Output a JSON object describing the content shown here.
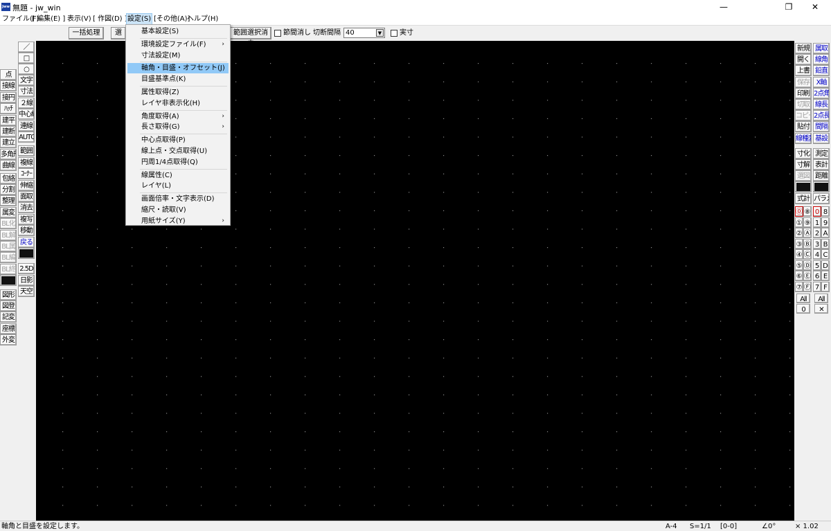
{
  "window": {
    "title": "無題 - jw_win",
    "app_icon_text": "Jww",
    "min": "—",
    "max": "❐",
    "close": "✕"
  },
  "menubar": {
    "items": [
      "ファイル(F)",
      "[ 編集(E) ]",
      "表示(V)",
      "[ 作図(D) ]",
      "設定(S)",
      "[その他(A)]",
      "ヘルプ(H)"
    ],
    "active_index": 4
  },
  "toolbar": {
    "batch_button": "一括処理",
    "partial_button": "選",
    "range_clear_button": "範囲選択消去",
    "node_clear_label": "節間消し",
    "cut_interval_label": "切断間隔",
    "cut_interval_value": "40",
    "actual_size_label": "実寸"
  },
  "dropdown": {
    "groups": [
      [
        {
          "label": "基本設定(S)"
        }
      ],
      [
        {
          "label": "環境設定ファイル(F)",
          "submenu": true
        },
        {
          "label": "寸法設定(M)"
        }
      ],
      [
        {
          "label": "軸角・目盛・オフセット(J)",
          "highlighted": true
        },
        {
          "label": "目盛基準点(K)"
        }
      ],
      [
        {
          "label": "属性取得(Z)"
        },
        {
          "label": "レイヤ非表示化(H)"
        }
      ],
      [
        {
          "label": "角度取得(A)",
          "submenu": true
        },
        {
          "label": "長さ取得(G)",
          "submenu": true
        }
      ],
      [
        {
          "label": "中心点取得(P)"
        },
        {
          "label": "線上点・交点取得(U)"
        },
        {
          "label": "円周1/4点取得(Q)"
        }
      ],
      [
        {
          "label": "線属性(C)"
        },
        {
          "label": "レイヤ(L)"
        }
      ],
      [
        {
          "label": "画面倍率・文字表示(D)"
        },
        {
          "label": "縮尺・読取(V)"
        },
        {
          "label": "用紙サイズ(Y)",
          "submenu": true
        }
      ]
    ],
    "arrow": "›"
  },
  "left_col1": [
    "点",
    "接線",
    "接円",
    "ﾊｯﾁ",
    "建平",
    "建断",
    "建立",
    "多角形",
    "曲線",
    "包絡",
    "分割",
    "整理",
    "属変",
    "BL化",
    "BL解",
    "BL属",
    "BL編",
    "BL終",
    "",
    "図形",
    "図登",
    "記変",
    "座標",
    "外変"
  ],
  "left_col2_shapes": {
    "line": "／",
    "rect": "□",
    "circle": "○"
  },
  "left_col2": [
    "文字",
    "寸法",
    "２線",
    "中心線",
    "連線",
    "AUTO",
    "範囲",
    "複線",
    "ｺｰﾅｰ",
    "伸縮",
    "面取",
    "消去",
    "複写",
    "移動",
    "戻る",
    "",
    "2.5D",
    "日影",
    "天空"
  ],
  "right_col1": [
    "新規",
    "開く",
    "上書",
    "保存",
    "印刷",
    "切取",
    "コピー",
    "貼付",
    "線種変更",
    "寸化",
    "寸解",
    "選図",
    "",
    "式計"
  ],
  "right_col2": [
    "属取",
    "線角",
    "鉛直",
    "X軸",
    "2点角",
    "線長",
    "2点長",
    "間隔",
    "基設",
    "測定",
    "表計",
    "距離",
    "",
    "パラメ"
  ],
  "layer_groups_left": {
    "rows": [
      [
        "⓪",
        "⑧"
      ],
      [
        "①",
        "⑨"
      ],
      [
        "②",
        "Ⓐ"
      ],
      [
        "③",
        "Ⓑ"
      ],
      [
        "④",
        "Ⓒ"
      ],
      [
        "⑤",
        "Ⓓ"
      ],
      [
        "⑥",
        "Ⓔ"
      ],
      [
        "⑦",
        "Ⓕ"
      ]
    ],
    "all": "All",
    "bottom": "0"
  },
  "layers_right": {
    "rows": [
      [
        "0",
        "8"
      ],
      [
        "1",
        "9"
      ],
      [
        "2",
        "A"
      ],
      [
        "3",
        "B"
      ],
      [
        "4",
        "C"
      ],
      [
        "5",
        "D"
      ],
      [
        "6",
        "E"
      ],
      [
        "7",
        "F"
      ]
    ],
    "all": "All",
    "bottom": "✕"
  },
  "status": {
    "message": "軸角と目盛を設定します。",
    "paper": "A-4",
    "scale": "S=1/1",
    "layer": "[0-0]",
    "angle": "∠0°",
    "zoom": "× 1.02"
  },
  "colors": {
    "canvas": "#000000",
    "grid": "#8a8a8a",
    "highlight": "#91c9f7",
    "blue_text": "#0000c8",
    "red_text": "#c00000"
  }
}
